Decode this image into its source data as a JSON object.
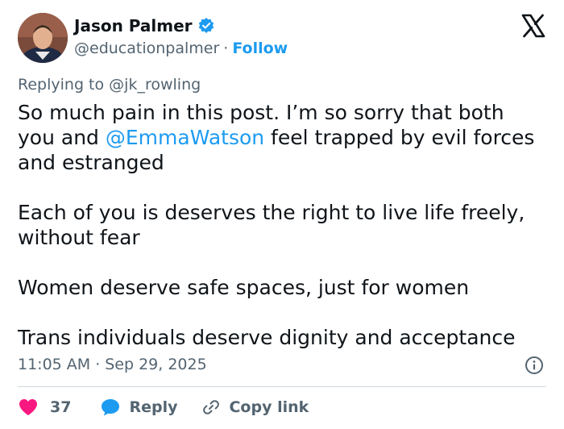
{
  "author": {
    "name": "Jason Palmer",
    "handle": "@educationpalmer",
    "separator": "·",
    "follow_label": "Follow"
  },
  "replying": {
    "prefix": "Replying to",
    "target": "@jk_rowling"
  },
  "tweet": {
    "line1": "So much pain in this post. I’m so sorry that both",
    "line2_pre": "you and ",
    "mention": "@EmmaWatson",
    "line2_post": " feel trapped by evil forces",
    "line3": "and estranged",
    "para2_line1": "Each of you is deserves the right to live life freely,",
    "para2_line2": "without fear",
    "para3": "Women deserve safe spaces, just for women",
    "para4": "Trans individuals deserve dignity and acceptance"
  },
  "meta": {
    "time": "11:05 AM",
    "separator": "·",
    "date": "Sep 29, 2025"
  },
  "actions": {
    "likes": "37",
    "reply_label": "Reply",
    "copy_label": "Copy link"
  },
  "colors": {
    "accent": "#1d9bf0",
    "like": "#f91880",
    "secondary_text": "#536471"
  },
  "icons": [
    "verified-badge-icon",
    "x-logo-icon",
    "info-icon",
    "heart-icon",
    "reply-bubble-icon",
    "link-icon"
  ]
}
